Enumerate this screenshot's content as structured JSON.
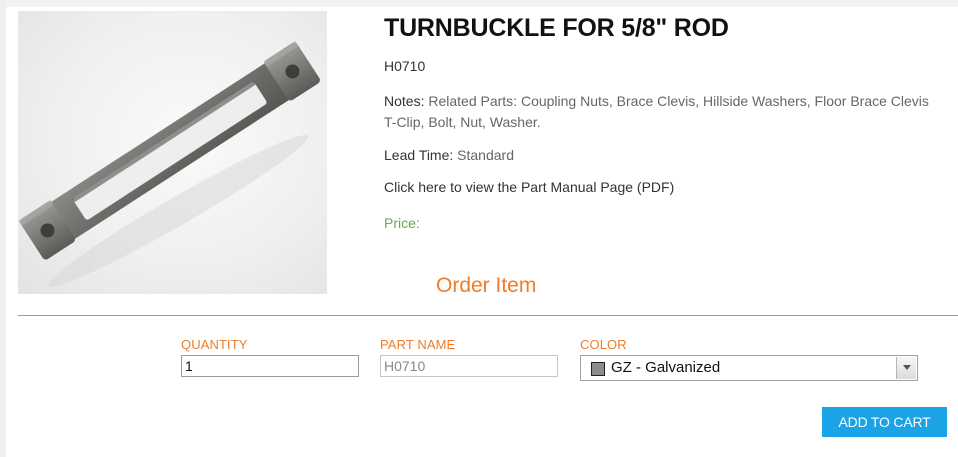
{
  "product": {
    "title": "TURNBUCKLE FOR 5/8\" ROD",
    "sku": "H0710",
    "notes_label": "Notes:",
    "notes_text": " Related Parts: Coupling Nuts, Brace Clevis, Hillside Washers, Floor Brace Clevis T-Clip, Bolt, Nut, Washer.",
    "lead_label": "Lead Time:",
    "lead_text": " Standard",
    "manual_link": "Click here to view the Part Manual Page (PDF)",
    "price_label": "Price:",
    "image": "turnbuckle-product-photo"
  },
  "order": {
    "heading": "Order Item",
    "quantity_label": "QUANTITY",
    "quantity_value": "1",
    "part_name_label": "PART NAME",
    "part_name_value": "H0710",
    "color_label": "COLOR",
    "color_value": "GZ - Galvanized",
    "color_swatch": "#8c8c8c",
    "add_to_cart": "ADD TO CART"
  },
  "colors": {
    "accent": "#f07c28",
    "button": "#1aa3e6",
    "price": "#6aa84f"
  }
}
